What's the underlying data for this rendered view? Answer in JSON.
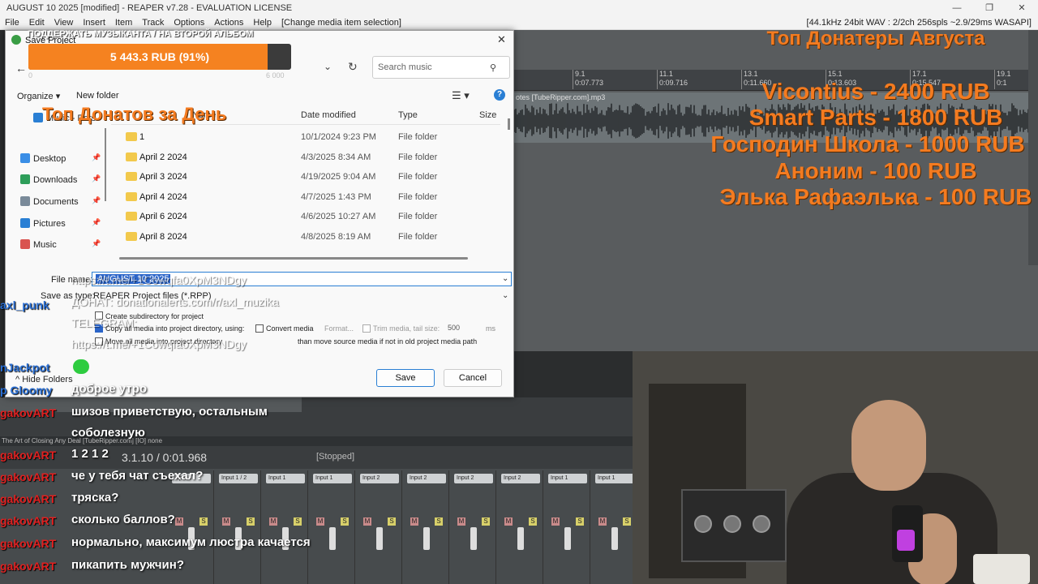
{
  "window": {
    "title": "AUGUST 10 2025 [modified] - REAPER v7.28 - EVALUATION LICENSE",
    "controls": [
      "—",
      "❐",
      "✕"
    ],
    "audio_status": "[44.1kHz 24bit WAV : 2/2ch 256spls ~2.9/29ms WASAPI]"
  },
  "menu": [
    "File",
    "Edit",
    "View",
    "Insert",
    "Item",
    "Track",
    "Options",
    "Actions",
    "Help",
    "[Change media item selection]"
  ],
  "timeline": {
    "ticks": [
      {
        "label": "9.1",
        "sub": "0:07.773"
      },
      {
        "label": "11.1",
        "sub": "0:09.716"
      },
      {
        "label": "13.1",
        "sub": "0:11.660"
      },
      {
        "label": "15.1",
        "sub": "0:13.603"
      },
      {
        "label": "17.1",
        "sub": "0:15.547"
      },
      {
        "label": "19.1",
        "sub": "0:1"
      }
    ],
    "clip_name": "otes [TubeRipper.com].mp3"
  },
  "donors": {
    "title": "Топ Донатеры Августа",
    "list": [
      "Vicontius - 2400 RUB",
      "Smart Parts - 1800 RUB",
      "Господин Школа - 1000 RUB",
      "Аноним - 100 RUB",
      "Элька Рафаэлька - 100 RUB"
    ]
  },
  "dialog": {
    "title": "Save Project",
    "search_placeholder": "Search music",
    "organize": "Organize ▾",
    "new_folder": "New folder",
    "nav": [
      {
        "label": "Music - Pers",
        "icon": "cloud-icon",
        "color": "#2a7fd4"
      },
      {
        "label": "Desktop",
        "icon": "desktop-icon",
        "color": "#3a8ee6"
      },
      {
        "label": "Downloads",
        "icon": "download-icon",
        "color": "#2e9e5a"
      },
      {
        "label": "Documents",
        "icon": "document-icon",
        "color": "#7a8a99"
      },
      {
        "label": "Pictures",
        "icon": "pictures-icon",
        "color": "#2a7fd4"
      },
      {
        "label": "Music",
        "icon": "music-icon",
        "color": "#d9534f"
      }
    ],
    "columns": [
      "Name",
      "Date modified",
      "Type",
      "Size"
    ],
    "rows": [
      {
        "name": "1",
        "date": "10/1/2024 9:23 PM",
        "type": "File folder"
      },
      {
        "name": "April 2 2024",
        "date": "4/3/2025 8:34 AM",
        "type": "File folder"
      },
      {
        "name": "April 3 2024",
        "date": "4/19/2025 9:04 AM",
        "type": "File folder"
      },
      {
        "name": "April 4 2024",
        "date": "4/7/2025 1:43 PM",
        "type": "File folder"
      },
      {
        "name": "April 6 2024",
        "date": "4/6/2025 10:27 AM",
        "type": "File folder"
      },
      {
        "name": "April 8 2024",
        "date": "4/8/2025 8:19 AM",
        "type": "File folder"
      }
    ],
    "file_name_label": "File name:",
    "file_name_value": "AUGUST 10 2025",
    "save_type_label": "Save as type:",
    "save_type_value": "REAPER Project files (*.RPP)",
    "options": {
      "create_subdir": "Create subdirectory for project",
      "copy_media": "Copy all media into project directory, using:",
      "convert_media": "Convert media",
      "format": "Format...",
      "trim_media": "Trim media, tail size:",
      "trim_value": "500",
      "trim_unit": "ms",
      "move_media": "Move all media into project directory",
      "move_media_tail": "than move source media if not in old project media path"
    },
    "hide_folders": "Hide Folders",
    "save": "Save",
    "cancel": "Cancel"
  },
  "stream": {
    "support_text": "ПОДДЕРЖАТЬ МУЗЫКАНТА / НА ВТОРОЙ АЛЬБОМ",
    "progress_text": "5 443.3 RUB (91%)",
    "progress_value": 91,
    "progress_min": "0",
    "progress_max": "6 000",
    "top_day": "Топ Донатов за День",
    "link1": "https://t.me/+1Cowqfa0XpM3NDgy",
    "donation_line": "ДОНАТ: donationalerts.com/r/axl_muzika",
    "telegram": "TELEGRAM:",
    "link2": "https://t.me/+1Cowqfa0XpM3NDgy"
  },
  "chat": [
    {
      "user": "axl_punk",
      "msg": "",
      "color": "#2a6fd4"
    },
    {
      "user": "nJackpot",
      "msg": "",
      "color": "#2a6fd4"
    },
    {
      "user": "p Gloomy",
      "msg": "доброе утро",
      "color": "#2a6fd4"
    },
    {
      "user": "gakovART",
      "msg": "шизов приветствую, остальным",
      "color": "#e02020"
    },
    {
      "user": "",
      "msg": "соболезную",
      "color": "#e02020"
    },
    {
      "user": "gakovART",
      "msg": "1 2 1 2",
      "color": "#e02020"
    },
    {
      "user": "gakovART",
      "msg": "че у тебя чат съехал?",
      "color": "#e02020"
    },
    {
      "user": "gakovART",
      "msg": "тряска?",
      "color": "#e02020"
    },
    {
      "user": "gakovART",
      "msg": "сколько баллов?",
      "color": "#e02020"
    },
    {
      "user": "gakovART",
      "msg": "нормально, максимум люстра качается",
      "color": "#e02020"
    },
    {
      "user": "gakovART",
      "msg": "пикапить мужчин?",
      "color": "#e02020"
    }
  ],
  "transport": {
    "clip_status": "The Art of Closing Any Deal [TubeRipper.com] [IO] none",
    "timecode": "3.1.10 / 0:01.968",
    "state": "[Stopped]"
  },
  "mixer": {
    "inputs": [
      "Input 1",
      "Input 1 / 2",
      "Input 1",
      "Input 1",
      "Input 2",
      "Input 2",
      "Input 2",
      "Input 2",
      "Input 1",
      "Input 1"
    ]
  }
}
